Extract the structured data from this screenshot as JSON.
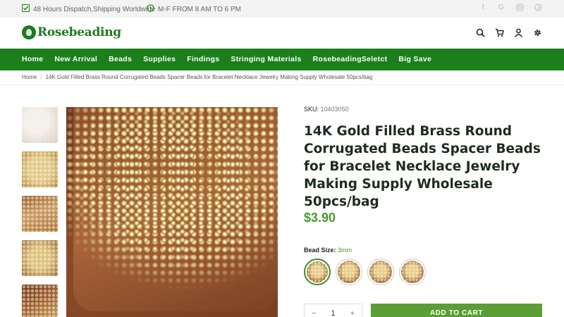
{
  "topbar": {
    "dispatch_text": "48 Hours Dispatch,Shipping Worldwide",
    "hours_text": "M-F FROM 8 AM TO 6 PM",
    "icons": [
      "check-box-icon",
      "clock-icon"
    ],
    "socials": [
      "facebook-icon",
      "google-icon",
      "instagram-icon",
      "pinterest-icon"
    ]
  },
  "header": {
    "logo_text": "Rosebeading",
    "icons": [
      "search-icon",
      "cart-icon",
      "account-icon",
      "settings-icon"
    ]
  },
  "nav": {
    "items": [
      "Home",
      "New Arrival",
      "Beads",
      "Supplies",
      "Findings",
      "Stringing Materials",
      "RosebeadingSeletct",
      "Big Save"
    ]
  },
  "breadcrumb": {
    "home": "Home",
    "separator": "/",
    "current": "14K Gold Filled Brass Round Corrugated Beads Spacer Beads for Bracelet Necklace Jewelry Making Supply Wholesale 50pcs/bag"
  },
  "product": {
    "sku_label": "SKU:",
    "sku_value": "10403050",
    "title": "14K Gold Filled Brass Round Corrugated Beads Spacer Beads for Bracelet Necklace Jewelry Making Supply Wholesale 50pcs/bag",
    "price": "$3.90",
    "option_label": "Bead Size:",
    "option_value": "3mm",
    "swatch_count": 4,
    "selected_swatch": 0,
    "quantity": "1",
    "qty_minus": "−",
    "qty_plus": "+",
    "add_to_cart": "ADD TO CART"
  },
  "gallery": {
    "thumbnail_count": 5
  },
  "colors": {
    "brand_green": "#1b7f1b",
    "price_green": "#4a9a2a",
    "button_green": "#5a9e35"
  }
}
